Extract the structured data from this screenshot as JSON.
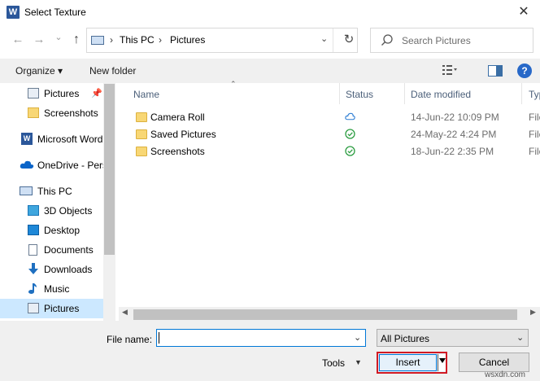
{
  "window": {
    "title": "Select Texture",
    "app_icon_letter": "W",
    "close_glyph": "✕"
  },
  "nav": {
    "back_glyph": "←",
    "forward_glyph": "→",
    "recent_glyph": "⌄",
    "up_glyph": "↑",
    "address_parts": [
      "This PC",
      "Pictures"
    ],
    "address_sep": "›",
    "address_dropdown_glyph": "⌄",
    "refresh_glyph": "↻",
    "search_placeholder": "Search Pictures"
  },
  "toolbar": {
    "organize_label": "Organize ▾",
    "new_folder_label": "New folder",
    "help_glyph": "?"
  },
  "sidebar": {
    "pin_glyph": "📌",
    "items": [
      {
        "label": "Pictures",
        "icon": "pictures-icon"
      },
      {
        "label": "Screenshots",
        "icon": "folder-icon"
      },
      {
        "label": "Microsoft Word",
        "icon": "word-icon"
      },
      {
        "label": "OneDrive - Pers",
        "icon": "cloud-icon"
      },
      {
        "label": "This PC",
        "icon": "pc-icon"
      },
      {
        "label": "3D Objects",
        "icon": "cube-icon"
      },
      {
        "label": "Desktop",
        "icon": "desktop-icon"
      },
      {
        "label": "Documents",
        "icon": "document-icon"
      },
      {
        "label": "Downloads",
        "icon": "download-icon"
      },
      {
        "label": "Music",
        "icon": "music-icon"
      },
      {
        "label": "Pictures",
        "icon": "pictures-icon"
      }
    ]
  },
  "list": {
    "columns": [
      "Name",
      "Status",
      "Date modified",
      "Typ"
    ],
    "sort_glyph": "⌃",
    "rows": [
      {
        "name": "Camera Roll",
        "status": "cloud",
        "date": "14-Jun-22 10:09 PM",
        "type": "File"
      },
      {
        "name": "Saved Pictures",
        "status": "synced",
        "date": "24-May-22 4:24 PM",
        "type": "File"
      },
      {
        "name": "Screenshots",
        "status": "synced",
        "date": "18-Jun-22 2:35 PM",
        "type": "File"
      }
    ],
    "status_colors": {
      "cloud": "#2b7cd3",
      "synced": "#2f9e44"
    },
    "scroll_left_glyph": "◀",
    "scroll_right_glyph": "▶"
  },
  "footer": {
    "file_name_label": "File name:",
    "file_name_value": "",
    "file_name_dropdown_glyph": "⌄",
    "filter_value": "All Pictures",
    "filter_dropdown_glyph": "⌄",
    "tools_label": "Tools",
    "tools_dropdown_glyph": "▼",
    "insert_label": "Insert",
    "cancel_label": "Cancel"
  },
  "watermark": "wsxdn.com",
  "colors": {
    "accent": "#0078d7",
    "highlight_border": "#d11a24",
    "selected_bg": "#cce8ff"
  }
}
